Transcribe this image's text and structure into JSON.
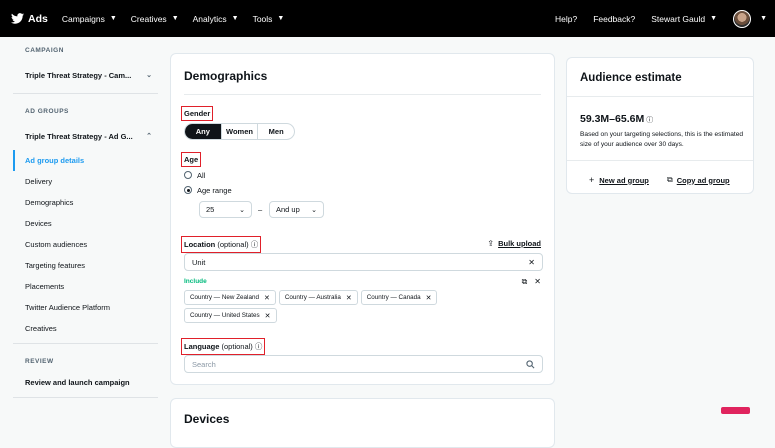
{
  "topbar": {
    "brand": "Ads",
    "nav": [
      "Campaigns",
      "Creatives",
      "Analytics",
      "Tools"
    ],
    "right": [
      "Help?",
      "Feedback?",
      "Stewart Gauld"
    ]
  },
  "sidebar": {
    "campaign_header": "CAMPAIGN",
    "campaign_name": "Triple Threat Strategy - Cam...",
    "adgroups_header": "AD GROUPS",
    "adgroup_name": "Triple Threat Strategy - Ad G...",
    "items": [
      "Ad group details",
      "Delivery",
      "Demographics",
      "Devices",
      "Custom audiences",
      "Targeting features",
      "Placements",
      "Twitter Audience Platform",
      "Creatives"
    ],
    "review_header": "REVIEW",
    "review_item": "Review and launch campaign"
  },
  "demographics": {
    "title": "Demographics",
    "gender_label": "Gender",
    "gender_options": [
      "Any",
      "Women",
      "Men"
    ],
    "gender_selected": "Any",
    "age_label": "Age",
    "age_all": "All",
    "age_range": "Age range",
    "age_from": "25",
    "age_sep": "–",
    "age_to": "And up",
    "location_label": "Location",
    "location_optional": "(optional)",
    "bulk_upload": "Bulk upload",
    "location_value": "Unit",
    "include_label": "Include",
    "chips": [
      "Country — New Zealand",
      "Country — Australia",
      "Country — Canada",
      "Country — United States"
    ],
    "language_label": "Language",
    "language_optional": "(optional)",
    "language_placeholder": "Search"
  },
  "devices": {
    "title": "Devices"
  },
  "audience": {
    "title": "Audience estimate",
    "range": "59.3M–65.6M",
    "desc": "Based on your targeting selections, this is the estimated size of your audience over 30 days.",
    "new_ad_group": "New ad group",
    "copy_ad_group": "Copy ad group"
  },
  "colors": {
    "accent": "#1d9bf0",
    "highlight": "#e0202a",
    "include": "#00ba7c"
  }
}
